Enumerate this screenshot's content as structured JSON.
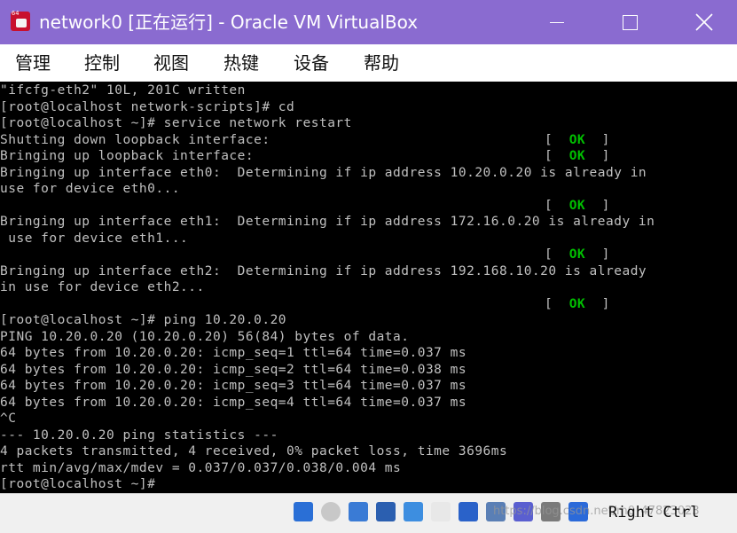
{
  "window": {
    "title": "network0 [正在运行] - Oracle VM VirtualBox",
    "icon_tag": "64"
  },
  "menu": {
    "items": [
      "管理",
      "控制",
      "视图",
      "热键",
      "设备",
      "帮助"
    ]
  },
  "terminal": {
    "lines": [
      {
        "text": "\"ifcfg-eth2\" 10L, 201C written"
      },
      {
        "text": "[root@localhost network-scripts]# cd"
      },
      {
        "text": "[root@localhost ~]# service network restart"
      },
      {
        "text": "Shutting down loopback interface:",
        "status": "OK"
      },
      {
        "text": "Bringing up loopback interface:",
        "status": "OK"
      },
      {
        "text": "Bringing up interface eth0:  Determining if ip address 10.20.0.20 is already in"
      },
      {
        "text": "use for device eth0..."
      },
      {
        "text": "",
        "status": "OK"
      },
      {
        "text": "Bringing up interface eth1:  Determining if ip address 172.16.0.20 is already in"
      },
      {
        "text": " use for device eth1..."
      },
      {
        "text": "",
        "status": "OK"
      },
      {
        "text": "Bringing up interface eth2:  Determining if ip address 192.168.10.20 is already"
      },
      {
        "text": "in use for device eth2..."
      },
      {
        "text": "",
        "status": "OK"
      },
      {
        "text": "[root@localhost ~]# ping 10.20.0.20"
      },
      {
        "text": "PING 10.20.0.20 (10.20.0.20) 56(84) bytes of data."
      },
      {
        "text": "64 bytes from 10.20.0.20: icmp_seq=1 ttl=64 time=0.037 ms"
      },
      {
        "text": "64 bytes from 10.20.0.20: icmp_seq=2 ttl=64 time=0.038 ms"
      },
      {
        "text": "64 bytes from 10.20.0.20: icmp_seq=3 ttl=64 time=0.037 ms"
      },
      {
        "text": "64 bytes from 10.20.0.20: icmp_seq=4 ttl=64 time=0.037 ms"
      },
      {
        "text": "^C"
      },
      {
        "text": "--- 10.20.0.20 ping statistics ---"
      },
      {
        "text": "4 packets transmitted, 4 received, 0% packet loss, time 3696ms"
      },
      {
        "text": "rtt min/avg/max/mdev = 0.037/0.037/0.038/0.004 ms"
      },
      {
        "text": "[root@localhost ~]#"
      }
    ]
  },
  "statusbar": {
    "host_key": "Right Ctrl",
    "watermark": "https://blog.csdn.net/m0_47823023",
    "icons": [
      {
        "name": "hard-disk-icon",
        "color": "#2a6fd6"
      },
      {
        "name": "optical-drive-icon",
        "color": "#c8c8c8"
      },
      {
        "name": "audio-icon",
        "color": "#3a7bd5"
      },
      {
        "name": "network-icon",
        "color": "#2b5fb0"
      },
      {
        "name": "usb-icon",
        "color": "#3d8ee0"
      },
      {
        "name": "shared-folders-icon",
        "color": "#e8e8e8"
      },
      {
        "name": "display-icon",
        "color": "#2a62c9"
      },
      {
        "name": "video-capture-icon",
        "color": "#5a7fb5"
      },
      {
        "name": "cpu-icon",
        "color": "#5a5fd0"
      },
      {
        "name": "mouse-integration-icon",
        "color": "#7a7a7a"
      },
      {
        "name": "keyboard-capture-icon",
        "color": "#2b6ad9"
      }
    ]
  }
}
